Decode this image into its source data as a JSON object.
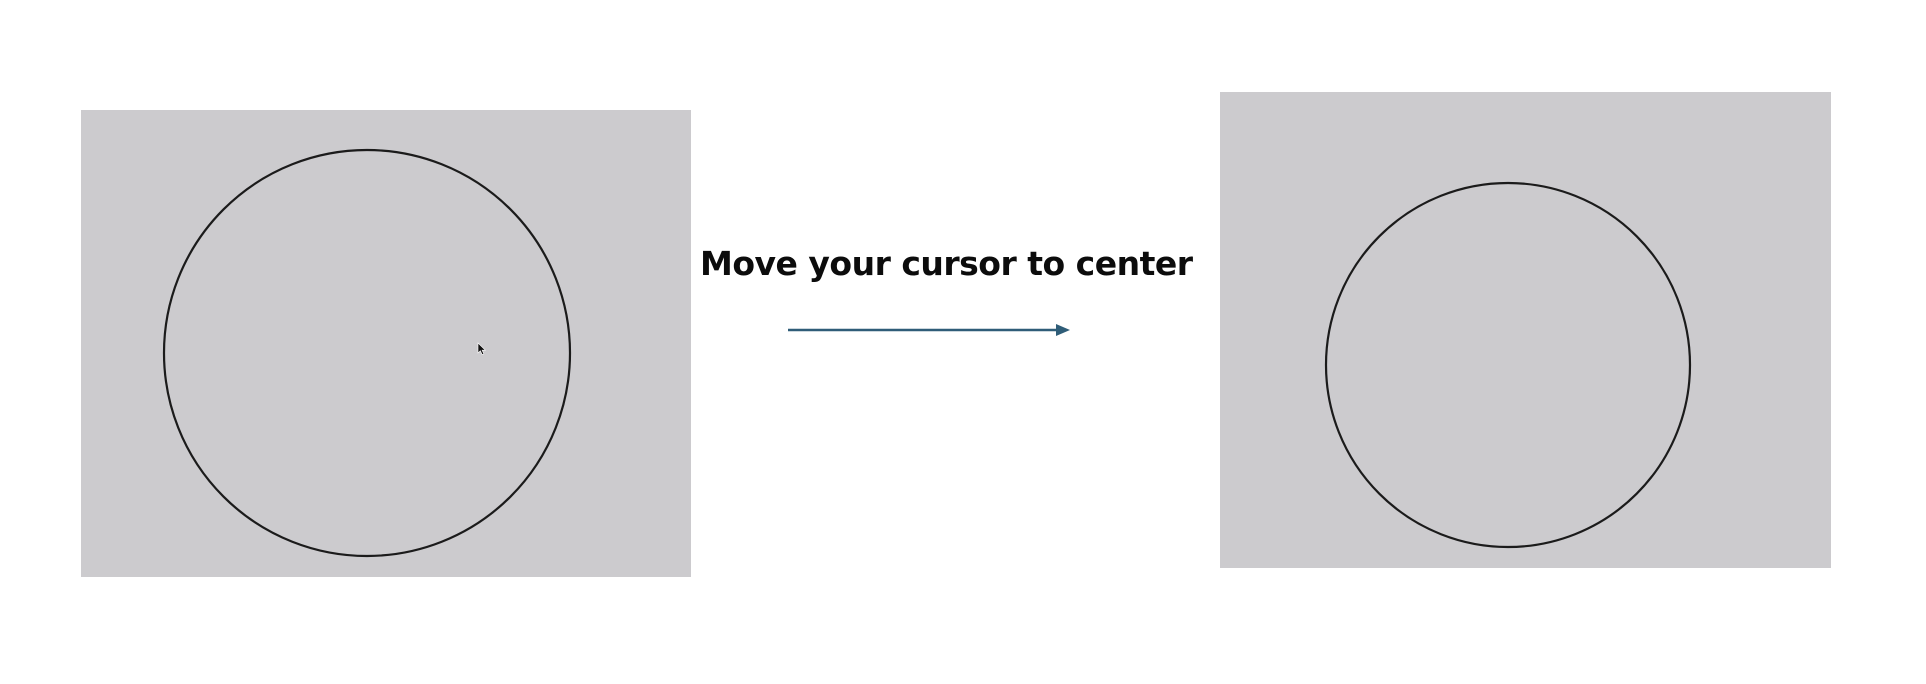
{
  "instruction": {
    "text": "Move your cursor to center"
  },
  "panels": {
    "before": {
      "background_color": "#cccbce",
      "shape": "circle",
      "has_cursor": true,
      "cursor_icon": "mouse-pointer-icon"
    },
    "after": {
      "background_color": "#cccbce",
      "shape": "circle",
      "has_cursor": false
    }
  },
  "arrow": {
    "direction": "right",
    "color": "#2f5d78"
  },
  "colors": {
    "circle_stroke": "#1b1b1b",
    "text": "#0c0c0c",
    "page_background": "#ffffff"
  }
}
